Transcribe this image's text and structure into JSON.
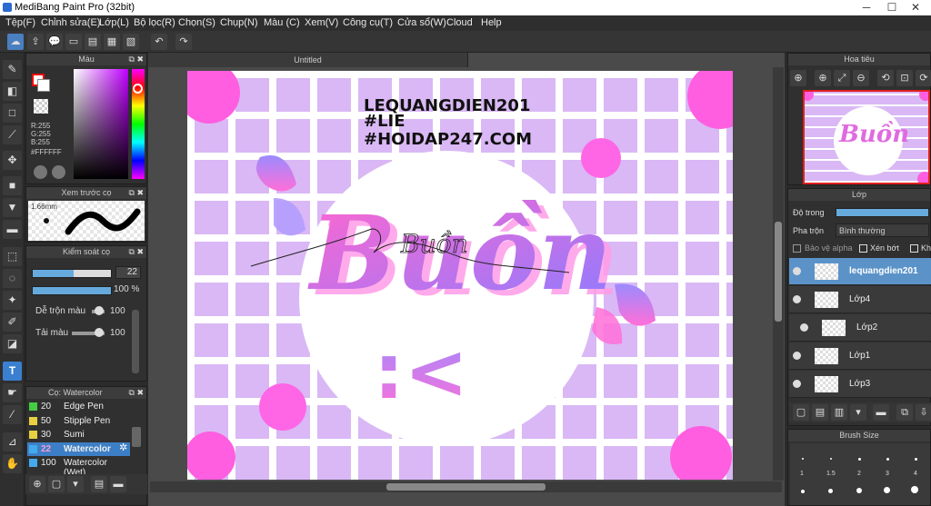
{
  "app": {
    "title": "MediBang Paint Pro (32bit)"
  },
  "menu": [
    "Tệp(F)",
    "Chỉnh sửa(E)",
    "Lớp(L)",
    "Bộ lọc(R)",
    "Chọn(S)",
    "Chụp(N)",
    "Màu (C)",
    "Xem(V)",
    "Công cụ(T)",
    "Cửa sổ(W)",
    "Cloud",
    "Help"
  ],
  "canvas": {
    "tab_title": "Untitled",
    "watermark": [
      "LEQUANGDIEN201",
      "#LIE",
      "#HOIDAP247.COM"
    ],
    "art_title": "Buồn",
    "sad_face": ":<",
    "signature": "Buồn"
  },
  "color_panel": {
    "title": "Màu",
    "r": "R:255",
    "g": "G:255",
    "b": "B:255",
    "hex": "#FFFFFF"
  },
  "brush_preview": {
    "title": "Xem trước cọ",
    "size": "1.66mm"
  },
  "brush_control": {
    "title": "Kiểm soát cọ",
    "size_value": "22",
    "opacity_value": "100 %",
    "size_fraction": 0.52,
    "opacity_fraction": 1.0,
    "blend_label": "Dễ trộn màu",
    "blend_value": "100",
    "amount_label": "Tải màu",
    "amount_value": "100"
  },
  "brush_list": {
    "title": "Cọ: Watercolor",
    "items": [
      {
        "num": "20",
        "name": "Edge Pen",
        "color": "#44cc44",
        "selected": false
      },
      {
        "num": "50",
        "name": "Stipple Pen",
        "color": "#e8d040",
        "selected": false
      },
      {
        "num": "30",
        "name": "Sumi",
        "color": "#e8d040",
        "selected": false
      },
      {
        "num": "22",
        "name": "Watercolor",
        "color": "#44aaee",
        "selected": true
      },
      {
        "num": "100",
        "name": "Watercolor (Wet)",
        "color": "#44aaee",
        "selected": false
      }
    ]
  },
  "navigator": {
    "title": "Hoa tiêu"
  },
  "layers": {
    "title": "Lớp",
    "opacity_label": "Độ trong",
    "blend_label": "Pha trộn",
    "blend_value": "Bình thường",
    "protect_alpha": "Bảo vệ alpha",
    "clipping": "Xén bớt",
    "lock_short": "Kh",
    "items": [
      "lequangdien201",
      "Lớp4",
      "Lớp2",
      "Lớp1",
      "Lớp3"
    ]
  },
  "brush_size": {
    "title": "Brush Size",
    "labels": [
      "1",
      "1.5",
      "2",
      "3",
      "4"
    ]
  },
  "colors": {
    "accent": "#66aadd",
    "purple_bg": "#d9b8f5",
    "pink": "#ff66d0",
    "lavender": "#a98cff"
  }
}
